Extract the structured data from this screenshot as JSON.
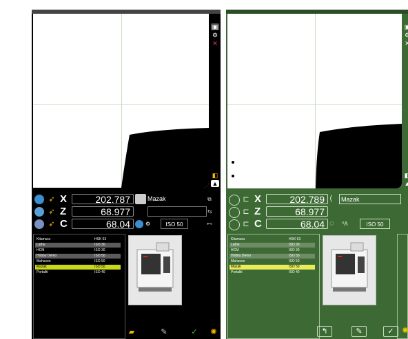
{
  "colors": {
    "left_bg": "#000000",
    "right_bg": "#3d6a34",
    "selection_left": "#c9d81a",
    "selection_right": "#e8ec5a"
  },
  "panels": [
    {
      "id": "left",
      "dro": [
        {
          "axis": "X",
          "value": "202.787",
          "side_label": "Mazak"
        },
        {
          "axis": "Z",
          "value": "68.977",
          "side_label": ""
        },
        {
          "axis": "C",
          "value": "68.04",
          "side_label": "ISO 50"
        }
      ],
      "machines": [
        {
          "name": "Kitamura",
          "spindle": "HSK 63"
        },
        {
          "name": "Lathe",
          "spindle": "ISO 30"
        },
        {
          "name": "HCM",
          "spindle": "ISO 30"
        },
        {
          "name": "Hobby Demo",
          "spindle": "ISO 50"
        },
        {
          "name": "Mahsoon",
          "spindle": "ISO 50"
        },
        {
          "name": "Mazak",
          "spindle": "ISO 50"
        },
        {
          "name": "Portaliti",
          "spindle": "ISO 40"
        }
      ],
      "selected_index": 5
    },
    {
      "id": "right",
      "dro": [
        {
          "axis": "X",
          "value": "202.789",
          "side_label": "Mazak"
        },
        {
          "axis": "Z",
          "value": "68.977",
          "side_label": ""
        },
        {
          "axis": "C",
          "value": "68.04",
          "side_label": "ISO 50"
        }
      ],
      "machines": [
        {
          "name": "Kitamura",
          "spindle": "HSK 63"
        },
        {
          "name": "Lathe",
          "spindle": "ISO 30"
        },
        {
          "name": "HCM",
          "spindle": "ISO 30"
        },
        {
          "name": "Hobby Demo",
          "spindle": "ISO 50"
        },
        {
          "name": "Mahsoon",
          "spindle": "ISO 50"
        },
        {
          "name": "Mazak",
          "spindle": "ISO 50"
        },
        {
          "name": "Portaliti",
          "spindle": "ISO 40"
        }
      ],
      "selected_index": 5
    }
  ],
  "icons": {
    "sidebar": [
      "camera-icon",
      "settings-icon",
      "close-icon"
    ],
    "bottom_left": [
      "folder-icon",
      "edit-icon",
      "check-icon",
      "sun-icon"
    ],
    "bottom_right": [
      "info-icon",
      "edit-icon",
      "check-icon",
      "sun-icon"
    ]
  }
}
